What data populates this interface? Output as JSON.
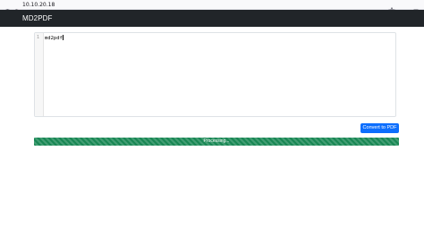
{
  "browser": {
    "url": "10.10.20.18",
    "icons": [
      "shield-icon",
      "lock-icon",
      "star-icon",
      "menu-icon"
    ]
  },
  "navbar": {
    "brand": "MD2PDF"
  },
  "editor": {
    "line_number": "1",
    "content": "md2pdf"
  },
  "actions": {
    "convert_label": "Convert to PDF"
  },
  "progress": {
    "label": "Processing...",
    "fraction": 1.0
  },
  "colors": {
    "navbar": "#212529",
    "primary": "#0d6efd",
    "success": "#198754"
  }
}
